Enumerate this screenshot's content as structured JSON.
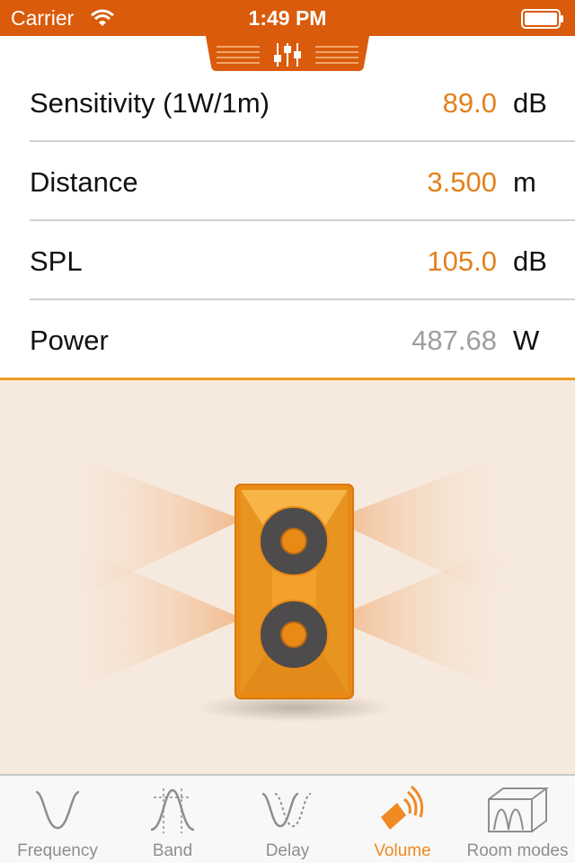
{
  "status_bar": {
    "carrier": "Carrier",
    "time": "1:49 PM"
  },
  "colors": {
    "accent": "#d95b0b",
    "value_orange": "#e4801a",
    "computed_gray": "#9e9e9e",
    "active_tab": "#f08a22"
  },
  "params": [
    {
      "label": "Sensitivity (1W/1m)",
      "value": "89.0",
      "unit": "dB"
    },
    {
      "label": "Distance",
      "value": "3.500",
      "unit": "m"
    },
    {
      "label": "SPL",
      "value": "105.0",
      "unit": "dB"
    },
    {
      "label": "Power",
      "value": "487.68",
      "unit": "W"
    }
  ],
  "tabs": [
    {
      "label": "Frequency",
      "icon": "sine-wave-icon",
      "active": false
    },
    {
      "label": "Band",
      "icon": "bandpass-curve-icon",
      "active": false
    },
    {
      "label": "Delay",
      "icon": "delay-waves-icon",
      "active": false
    },
    {
      "label": "Volume",
      "icon": "speaker-volume-icon",
      "active": true
    },
    {
      "label": "Room modes",
      "icon": "room-modes-icon",
      "active": false
    }
  ]
}
